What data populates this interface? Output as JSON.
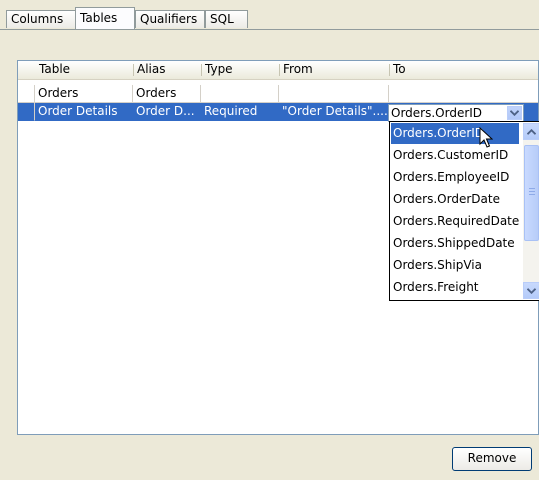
{
  "tabs": [
    {
      "label": "Columns",
      "active": false
    },
    {
      "label": "Tables",
      "active": true
    },
    {
      "label": "Qualifiers",
      "active": false
    },
    {
      "label": "SQL",
      "active": false
    }
  ],
  "grid": {
    "headers": [
      "Table",
      "Alias",
      "Type",
      "From",
      "To"
    ],
    "rows": [
      {
        "table": "Orders",
        "alias": "Orders",
        "type": "",
        "from": "",
        "to": "",
        "selected": false
      },
      {
        "table": "Order Details",
        "alias": "Order D...",
        "type": "Required",
        "from": "\"Order Details\"....",
        "to": "Orders.OrderID",
        "selected": true
      }
    ]
  },
  "combo": {
    "value": "Orders.OrderID"
  },
  "dropdown": {
    "items": [
      "Orders.OrderID",
      "Orders.CustomerID",
      "Orders.EmployeeID",
      "Orders.OrderDate",
      "Orders.RequiredDate",
      "Orders.ShippedDate",
      "Orders.ShipVia",
      "Orders.Freight"
    ],
    "selected_index": 0
  },
  "actions": {
    "remove_label": "Remove"
  },
  "icons": {
    "combo_button": "chevron-down-icon",
    "scroll_up": "chevron-up-icon",
    "scroll_down": "chevron-down-icon",
    "cursor": "mouse-pointer-icon"
  },
  "colors": {
    "selection": "#316ac5",
    "panel": "#ece9d8",
    "border": "#7f9db9"
  }
}
